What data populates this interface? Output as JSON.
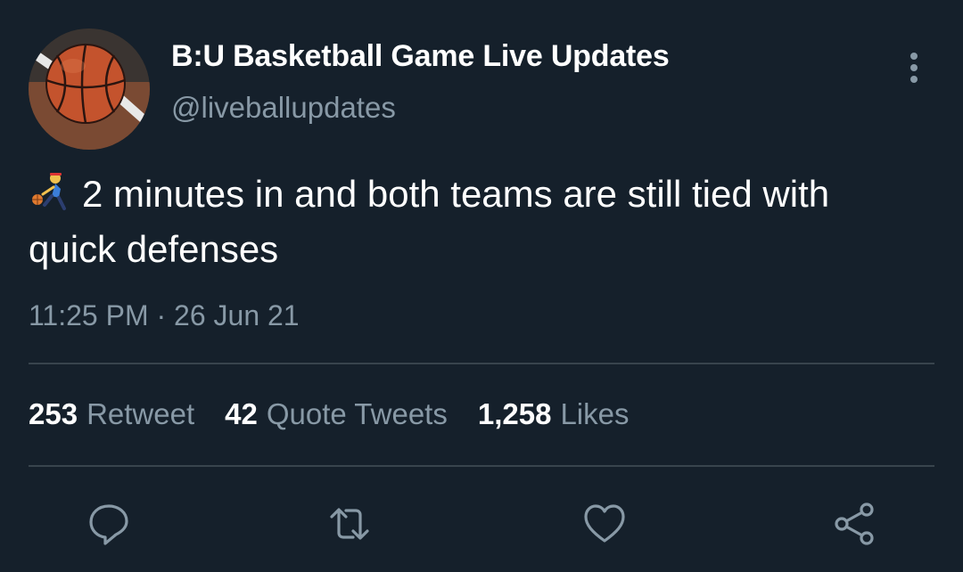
{
  "header": {
    "display_name": "B:U Basketball Game Live Updates",
    "handle": "@liveballupdates",
    "avatar_icon": "basketball-icon"
  },
  "tweet": {
    "emoji": "person-bouncing-ball",
    "text": "2 minutes in and both teams are still tied with quick defenses",
    "timestamp": "11:25 PM · 26 Jun 21"
  },
  "stats": {
    "retweets_count": "253",
    "retweets_label": "Retweet",
    "quotes_count": "42",
    "quotes_label": "Quote Tweets",
    "likes_count": "1,258",
    "likes_label": "Likes"
  },
  "actions": [
    "reply-icon",
    "retweet-icon",
    "like-icon",
    "share-icon"
  ],
  "colors": {
    "background": "#15202b",
    "secondary_text": "#8899a6",
    "divider": "#38444d",
    "primary_text": "#ffffff"
  }
}
